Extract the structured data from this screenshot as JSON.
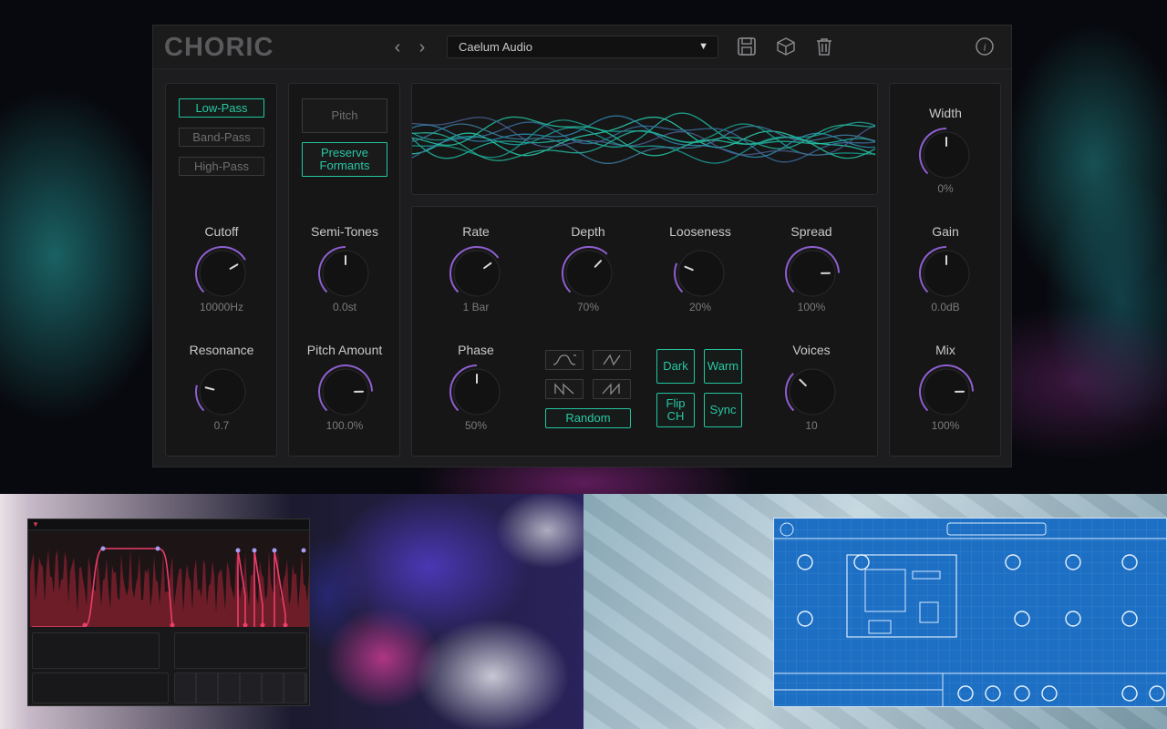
{
  "header": {
    "title": "CHORIC",
    "preset": "Caelum Audio"
  },
  "colors": {
    "accent": "#22c6a0",
    "knob_arc": "#8e5fd0",
    "panel": "#1d1d1f"
  },
  "filter": {
    "modes": [
      "Low-Pass",
      "Band-Pass",
      "High-Pass"
    ],
    "selected_mode": "Low-Pass",
    "cutoff": {
      "label": "Cutoff",
      "value": "10000Hz",
      "norm": 0.72
    },
    "resonance": {
      "label": "Resonance",
      "value": "0.7",
      "norm": 0.22
    }
  },
  "pitch": {
    "pitch_btn": "Pitch",
    "formants_btn": "Preserve Formants",
    "semitones": {
      "label": "Semi-Tones",
      "value": "0.0st",
      "norm": 0.5
    },
    "amount": {
      "label": "Pitch Amount",
      "value": "100.0%",
      "norm": 0.83
    }
  },
  "chorus": {
    "rate": {
      "label": "Rate",
      "value": "1 Bar",
      "norm": 0.7
    },
    "depth": {
      "label": "Depth",
      "value": "70%",
      "norm": 0.66
    },
    "looseness": {
      "label": "Looseness",
      "value": "20%",
      "norm": 0.25
    },
    "spread": {
      "label": "Spread",
      "value": "100%",
      "norm": 0.83
    },
    "phase": {
      "label": "Phase",
      "value": "50%",
      "norm": 0.5
    },
    "voices": {
      "label": "Voices",
      "value": "10",
      "norm": 0.33
    },
    "random_btn": "Random",
    "toggles": [
      "Dark",
      "Warm",
      "Flip\nCH",
      "Sync"
    ],
    "wave_shapes": [
      "sine-icon",
      "triangle-icon",
      "ramp-down-icon",
      "ramp-up-icon"
    ]
  },
  "output": {
    "width": {
      "label": "Width",
      "value": "0%",
      "norm": 0.5
    },
    "gain": {
      "label": "Gain",
      "value": "0.0dB",
      "norm": 0.5
    },
    "mix": {
      "label": "Mix",
      "value": "100%",
      "norm": 0.83
    }
  }
}
